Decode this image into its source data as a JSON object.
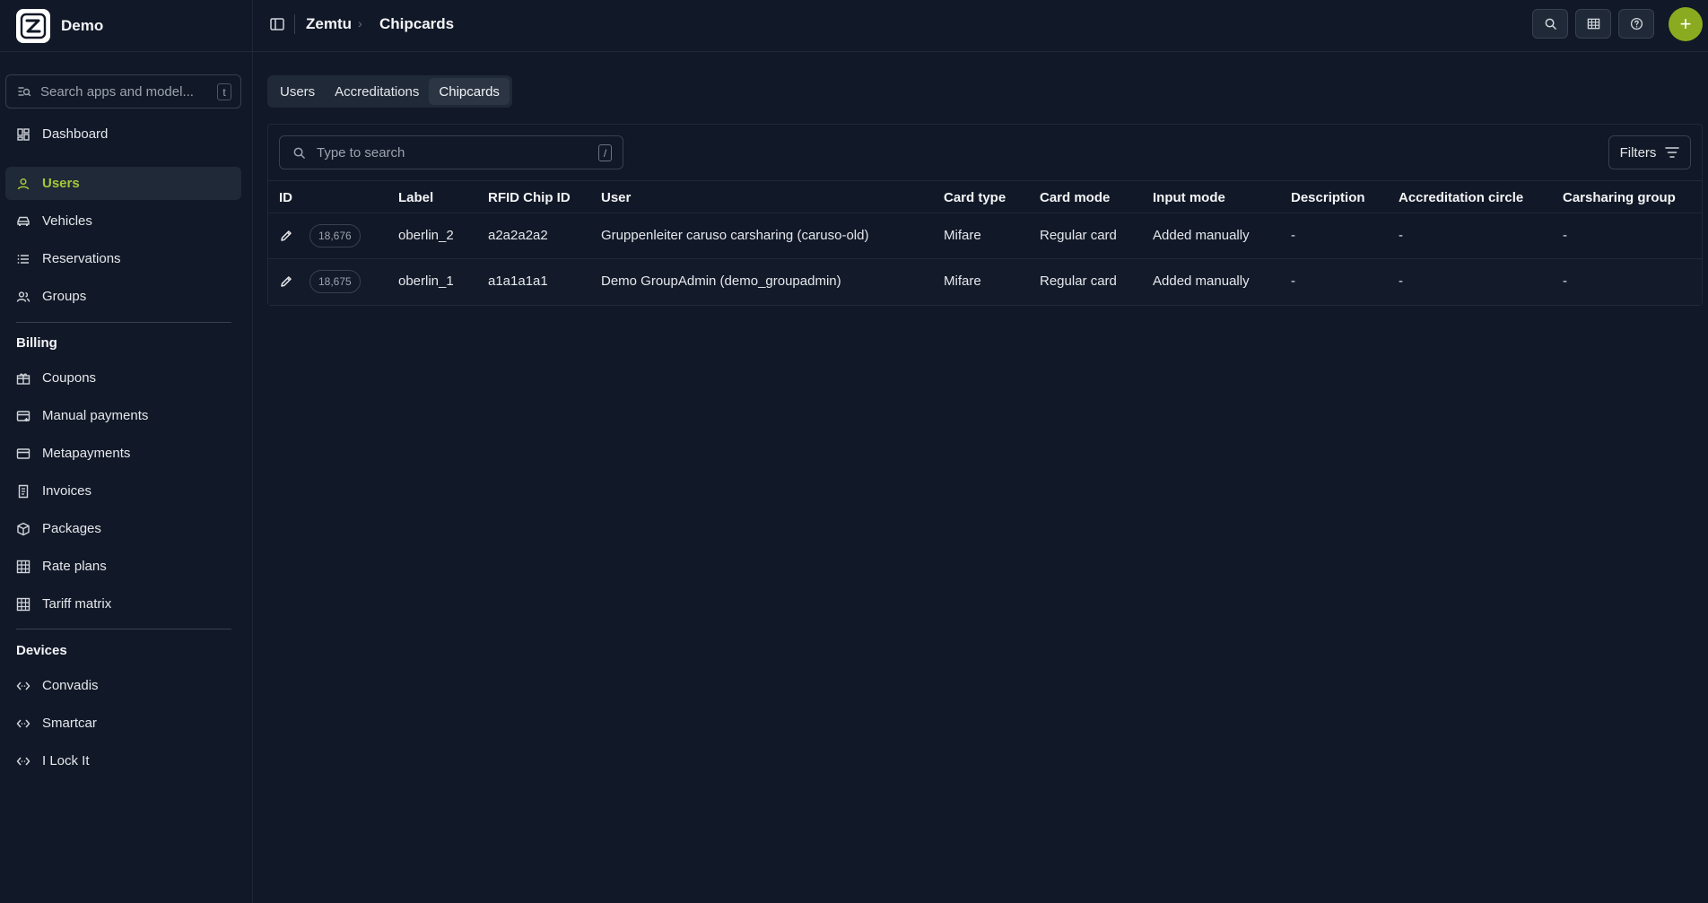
{
  "app": {
    "name": "Demo"
  },
  "sidebar": {
    "search_placeholder": "Search apps and model...",
    "search_shortcut": "t",
    "main_items": [
      {
        "label": "Dashboard",
        "icon": "dashboard-icon"
      },
      {
        "label": "Users",
        "icon": "user-icon",
        "active": true
      },
      {
        "label": "Vehicles",
        "icon": "car-icon"
      },
      {
        "label": "Reservations",
        "icon": "list-icon"
      },
      {
        "label": "Groups",
        "icon": "group-icon"
      }
    ],
    "billing_title": "Billing",
    "billing_items": [
      {
        "label": "Coupons",
        "icon": "coupon-icon"
      },
      {
        "label": "Manual payments",
        "icon": "card-add-icon"
      },
      {
        "label": "Metapayments",
        "icon": "credit-card-icon"
      },
      {
        "label": "Invoices",
        "icon": "receipt-icon"
      },
      {
        "label": "Packages",
        "icon": "package-icon"
      },
      {
        "label": "Rate plans",
        "icon": "table-icon"
      },
      {
        "label": "Tariff matrix",
        "icon": "table-icon"
      }
    ],
    "devices_title": "Devices",
    "devices_items": [
      {
        "label": "Convadis",
        "icon": "code-icon"
      },
      {
        "label": "Smartcar",
        "icon": "code-icon"
      },
      {
        "label": "I Lock It",
        "icon": "code-icon"
      }
    ]
  },
  "topbar": {
    "breadcrumb": [
      "Zemtu",
      "Chipcards"
    ],
    "add_label": "+"
  },
  "tabs": [
    {
      "label": "Users"
    },
    {
      "label": "Accreditations"
    },
    {
      "label": "Chipcards",
      "active": true
    }
  ],
  "table": {
    "search_placeholder": "Type to search",
    "search_shortcut": "/",
    "filters_label": "Filters",
    "columns": [
      "ID",
      "Label",
      "RFID Chip ID",
      "User",
      "Card type",
      "Card mode",
      "Input mode",
      "Description",
      "Accreditation circle",
      "Carsharing group"
    ],
    "rows": [
      {
        "id": "18,676",
        "label": "oberlin_2",
        "rfid": "a2a2a2a2",
        "user": "Gruppenleiter caruso carsharing (caruso-old)",
        "card_type": "Mifare",
        "card_mode": "Regular card",
        "input_mode": "Added manually",
        "description": "-",
        "accreditation_circle": "-",
        "carsharing_group": "-"
      },
      {
        "id": "18,675",
        "label": "oberlin_1",
        "rfid": "a1a1a1a1",
        "user": "Demo GroupAdmin (demo_groupadmin)",
        "card_type": "Mifare",
        "card_mode": "Regular card",
        "input_mode": "Added manually",
        "description": "-",
        "accreditation_circle": "-",
        "carsharing_group": "-"
      }
    ]
  },
  "colors": {
    "accent": "#a3c83a",
    "add_button": "#8aab1f",
    "background": "#111827"
  }
}
